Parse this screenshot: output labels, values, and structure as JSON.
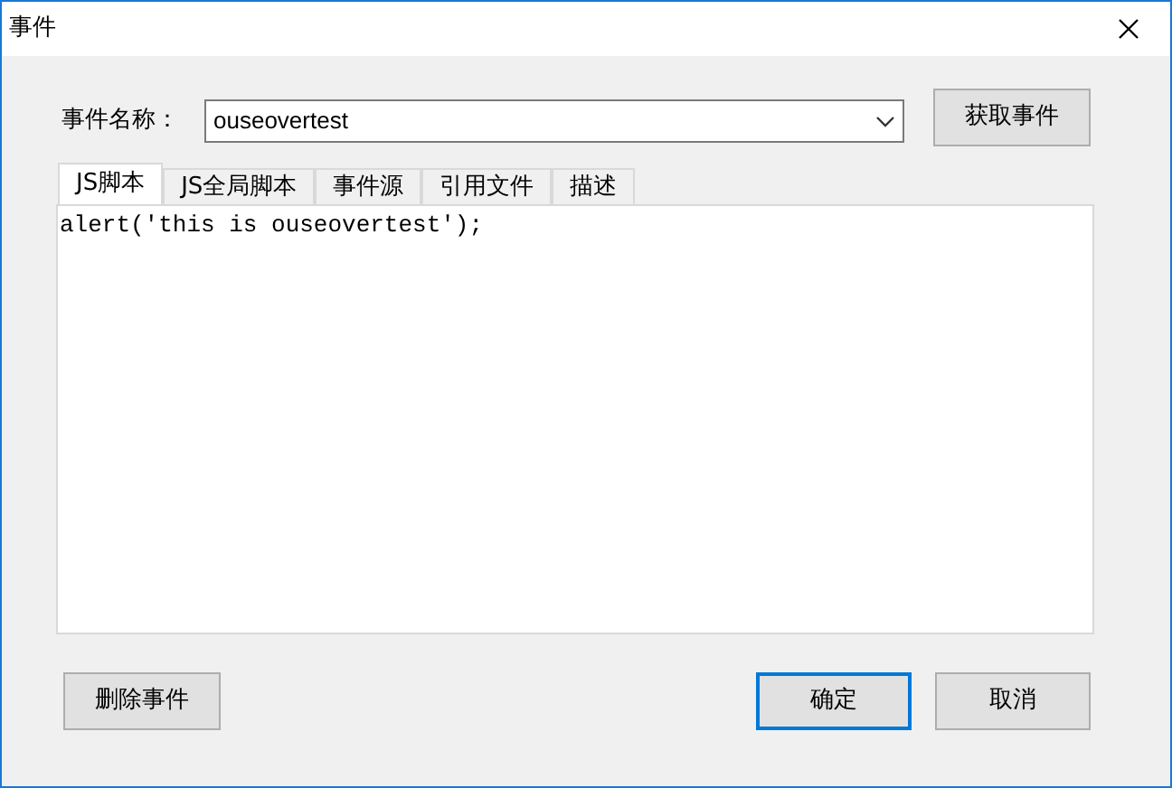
{
  "window": {
    "title": "事件"
  },
  "event_name": {
    "label": "事件名称：",
    "value": "ouseovertest"
  },
  "fetch_button": "获取事件",
  "tabs": [
    {
      "label": "JS脚本",
      "selected": true
    },
    {
      "label": "JS全局脚本",
      "selected": false
    },
    {
      "label": "事件源",
      "selected": false
    },
    {
      "label": "引用文件",
      "selected": false
    },
    {
      "label": "描述",
      "selected": false
    }
  ],
  "editor": {
    "text": "alert('this is ouseovertest');"
  },
  "delete_button": "删除事件",
  "buttons": [
    {
      "label": "确定",
      "default": true
    },
    {
      "label": "取消",
      "default": false
    }
  ]
}
